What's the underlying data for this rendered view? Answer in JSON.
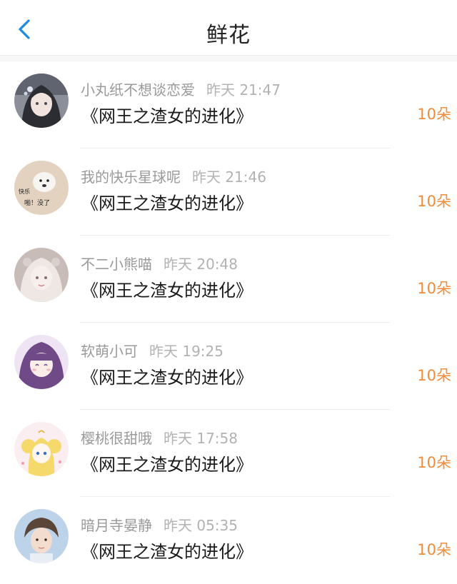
{
  "header": {
    "title": "鲜花",
    "back_icon": "chevron-left-icon",
    "accent_color": "#1e88e5"
  },
  "list": {
    "amount_color": "#f08c3a",
    "items": [
      {
        "user": "小丸纸不想谈恋爱",
        "time": "昨天 21:47",
        "book": "《网王之渣女的进化》",
        "amount": "10朵",
        "avatar_text": ""
      },
      {
        "user": "我的快乐星球呢",
        "time": "昨天 21:46",
        "book": "《网王之渣女的进化》",
        "amount": "10朵",
        "avatar_text": "快乐 啪！没了"
      },
      {
        "user": "不二小熊喵",
        "time": "昨天 20:48",
        "book": "《网王之渣女的进化》",
        "amount": "10朵",
        "avatar_text": ""
      },
      {
        "user": "软萌小可",
        "time": "昨天 19:25",
        "book": "《网王之渣女的进化》",
        "amount": "10朵",
        "avatar_text": ""
      },
      {
        "user": "樱桃很甜哦",
        "time": "昨天 17:58",
        "book": "《网王之渣女的进化》",
        "amount": "10朵",
        "avatar_text": ""
      },
      {
        "user": "暗月寺晏静",
        "time": "昨天 05:35",
        "book": "《网王之渣女的进化》",
        "amount": "10朵",
        "avatar_text": ""
      }
    ]
  }
}
